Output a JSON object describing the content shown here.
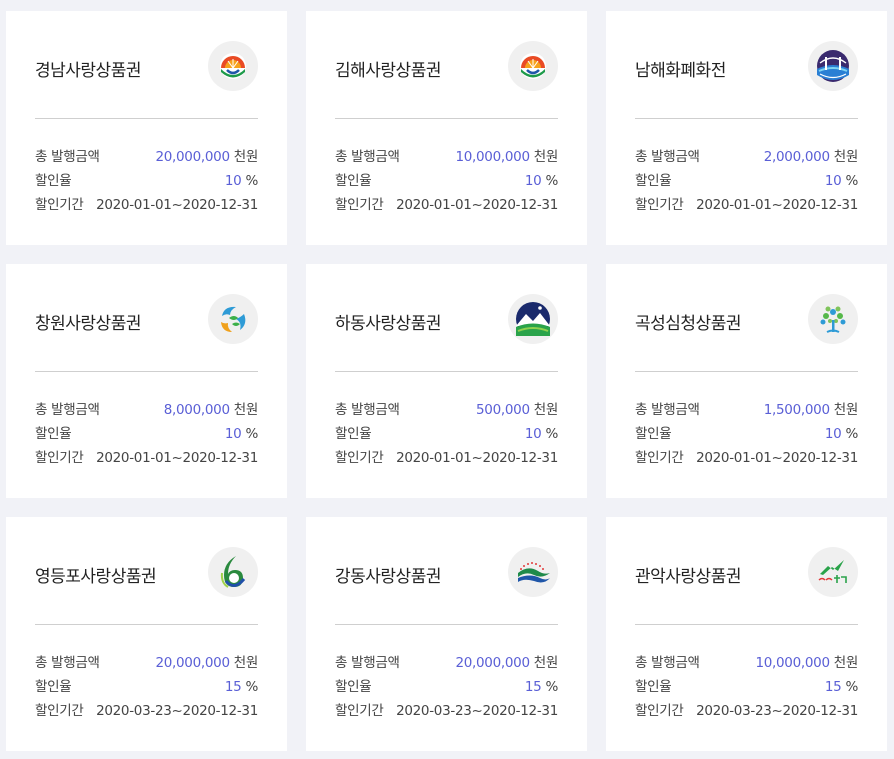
{
  "labels": {
    "total_issue": "총 발행금액",
    "discount_rate": "할인율",
    "discount_period": "할인기간",
    "unit_thousand_won": "천원",
    "unit_percent": "%"
  },
  "cards": [
    {
      "title": "경남사랑상품권",
      "logo": "gyeongnam-logo-icon",
      "amount": "20,000,000",
      "rate": "10",
      "period": "2020-01-01~2020-12-31"
    },
    {
      "title": "김해사랑상품권",
      "logo": "gimhae-logo-icon",
      "amount": "10,000,000",
      "rate": "10",
      "period": "2020-01-01~2020-12-31"
    },
    {
      "title": "남해화폐화전",
      "logo": "namhae-logo-icon",
      "amount": "2,000,000",
      "rate": "10",
      "period": "2020-01-01~2020-12-31"
    },
    {
      "title": "창원사랑상품권",
      "logo": "changwon-logo-icon",
      "amount": "8,000,000",
      "rate": "10",
      "period": "2020-01-01~2020-12-31"
    },
    {
      "title": "하동사랑상품권",
      "logo": "hadong-logo-icon",
      "amount": "500,000",
      "rate": "10",
      "period": "2020-01-01~2020-12-31"
    },
    {
      "title": "곡성심청상품권",
      "logo": "gokseong-logo-icon",
      "amount": "1,500,000",
      "rate": "10",
      "period": "2020-01-01~2020-12-31"
    },
    {
      "title": "영등포사랑상품권",
      "logo": "yeongdeungpo-logo-icon",
      "amount": "20,000,000",
      "rate": "15",
      "period": "2020-03-23~2020-12-31"
    },
    {
      "title": "강동사랑상품권",
      "logo": "gangdong-logo-icon",
      "amount": "20,000,000",
      "rate": "15",
      "period": "2020-03-23~2020-12-31"
    },
    {
      "title": "관악사랑상품권",
      "logo": "gwanak-logo-icon",
      "amount": "10,000,000",
      "rate": "15",
      "period": "2020-03-23~2020-12-31"
    }
  ],
  "colors": {
    "accent": "#5a5fd6",
    "background": "#f1f2f7",
    "card": "#ffffff"
  }
}
